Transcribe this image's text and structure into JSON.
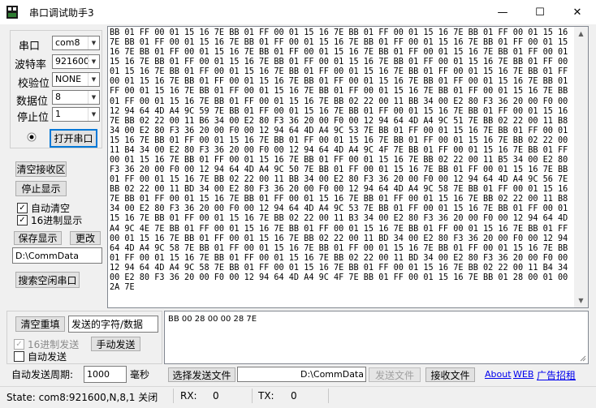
{
  "window": {
    "title": "串口调试助手3",
    "controls": {
      "minimize": "—",
      "maximize": "☐",
      "close": "✕"
    }
  },
  "serial": {
    "port_label": "串口",
    "port_value": "com8",
    "baud_label": "波特率",
    "baud_value": "921600",
    "parity_label": "校验位",
    "parity_value": "NONE",
    "databits_label": "数据位",
    "databits_value": "8",
    "stopbits_label": "停止位",
    "stopbits_value": "1",
    "open_button": "打开串口"
  },
  "receive_controls": {
    "clear_button": "清空接收区",
    "stop_button": "停止显示",
    "auto_clear_label": "自动清空",
    "auto_clear_checked": true,
    "hex_display_label": "16进制显示",
    "hex_display_checked": true,
    "save_button": "保存显示",
    "change_button": "更改",
    "path_value": "D:\\CommData",
    "search_button": "搜索空闲串口"
  },
  "receive_lines": [
    "BB 01 FF 00 01 15 16 7E BB 01 FF 00 01 15 16 7E BB 01 FF 00 01 15 16 7E BB 01 FF 00 01 15 16",
    "7E BB 01 FF 00 01 15 16 7E BB 01 FF 00 01 15 16 7E BB 01 FF 00 01 15 16 7E BB 01 FF 00 01 15",
    "16 7E BB 01 FF 00 01 15 16 7E BB 01 FF 00 01 15 16 7E BB 01 FF 00 01 15 16 7E BB 01 FF 00 01",
    "15 16 7E BB 01 FF 00 01 15 16 7E BB 01 FF 00 01 15 16 7E BB 01 FF 00 01 15 16 7E BB 01 FF 00",
    "01 15 16 7E BB 01 FF 00 01 15 16 7E BB 01 FF 00 01 15 16 7E BB 01 FF 00 01 15 16 7E BB 01 FF",
    "00 01 15 16 7E BB 01 FF 00 01 15 16 7E BB 01 FF 00 01 15 16 7E BB 01 FF 00 01 15 16 7E BB 01",
    "FF 00 01 15 16 7E BB 01 FF 00 01 15 16 7E BB 01 FF 00 01 15 16 7E BB 01 FF 00 01 15 16 7E BB",
    "01 FF 00 01 15 16 7E BB 01 FF 00 01 15 16 7E BB 02 22 00 11 BB 34 00 E2 80 F3 36 20 00 F0 00",
    "12 94 64 4D A4 9C 59 7E BB 01 FF 00 01 15 16 7E BB 01 FF 00 01 15 16 7E BB 01 FF 00 01 15 16",
    "7E BB 02 22 00 11 B6 34 00 E2 80 F3 36 20 00 F0 00 12 94 64 4D A4 9C 51 7E BB 02 22 00 11 B8",
    "34 00 E2 80 F3 36 20 00 F0 00 12 94 64 4D A4 9C 53 7E BB 01 FF 00 01 15 16 7E BB 01 FF 00 01",
    "15 16 7E BB 01 FF 00 01 15 16 7E BB 01 FF 00 01 15 16 7E BB 01 FF 00 01 15 16 7E BB 02 22 00",
    "11 B4 34 00 E2 80 F3 36 20 00 F0 00 12 94 64 4D A4 9C 4F 7E BB 01 FF 00 01 15 16 7E BB 01 FF",
    "00 01 15 16 7E BB 01 FF 00 01 15 16 7E BB 01 FF 00 01 15 16 7E BB 02 22 00 11 B5 34 00 E2 80",
    "F3 36 20 00 F0 00 12 94 64 4D A4 9C 50 7E BB 01 FF 00 01 15 16 7E BB 01 FF 00 01 15 16 7E BB",
    "01 FF 00 01 15 16 7E BB 02 22 00 11 BB 34 00 E2 80 F3 36 20 00 F0 00 12 94 64 4D A4 9C 56 7E",
    "BB 02 22 00 11 BD 34 00 E2 80 F3 36 20 00 F0 00 12 94 64 4D A4 9C 58 7E BB 01 FF 00 01 15 16",
    "7E BB 01 FF 00 01 15 16 7E BB 01 FF 00 01 15 16 7E BB 01 FF 00 01 15 16 7E BB 02 22 00 11 B8",
    "34 00 E2 80 F3 36 20 00 F0 00 12 94 64 4D A4 9C 53 7E BB 01 FF 00 01 15 16 7E BB 01 FF 00 01",
    "15 16 7E BB 01 FF 00 01 15 16 7E BB 02 22 00 11 B3 34 00 E2 80 F3 36 20 00 F0 00 12 94 64 4D",
    "A4 9C 4E 7E BB 01 FF 00 01 15 16 7E BB 01 FF 00 01 15 16 7E BB 01 FF 00 01 15 16 7E BB 01 FF",
    "00 01 15 16 7E BB 01 FF 00 01 15 16 7E BB 02 22 00 11 BD 34 00 E2 80 F3 36 20 00 F0 00 12 94",
    "64 4D A4 9C 58 7E BB 01 FF 00 01 15 16 7E BB 01 FF 00 01 15 16 7E BB 01 FF 00 01 15 16 7E BB",
    "01 FF 00 01 15 16 7E BB 01 FF 00 01 15 16 7E BB 02 22 00 11 BD 34 00 E2 80 F3 36 20 00 F0 00",
    "12 94 64 4D A4 9C 58 7E BB 01 FF 00 01 15 16 7E BB 01 FF 00 01 15 16 7E BB 02 22 00 11 B4 34",
    "00 E2 80 F3 36 20 00 F0 00 12 94 64 4D A4 9C 4F 7E BB 01 FF 00 01 15 16 7E BB 01 28 00 01 00",
    "2A 7E"
  ],
  "send_controls": {
    "clear_resend_button": "清空重填",
    "send_chars_label": "发送的字符/数据",
    "hex_send_label": "16进制发送",
    "hex_send_checked": true,
    "manual_send_button": "手动发送",
    "auto_send_label": "自动发送",
    "auto_send_checked": false,
    "period_label": "自动发送周期:",
    "period_value": "1000",
    "period_unit": "毫秒",
    "send_text": "BB 00 28 00 00 28 7E"
  },
  "file_controls": {
    "select_file_button": "选择发送文件",
    "file_path": "D:\\CommData",
    "send_file_button": "发送文件",
    "receive_file_button": "接收文件"
  },
  "links": {
    "about": "About",
    "web": "WEB",
    "ad": "广告招租"
  },
  "status": {
    "state": "State: com8:921600,N,8,1 关闭",
    "rx_label": "RX:",
    "rx_value": "0",
    "tx_label": "TX:",
    "tx_value": "0"
  },
  "colors": {
    "link": "#0000ee",
    "focus": "#0078d7",
    "background": "#f0f0f0"
  }
}
